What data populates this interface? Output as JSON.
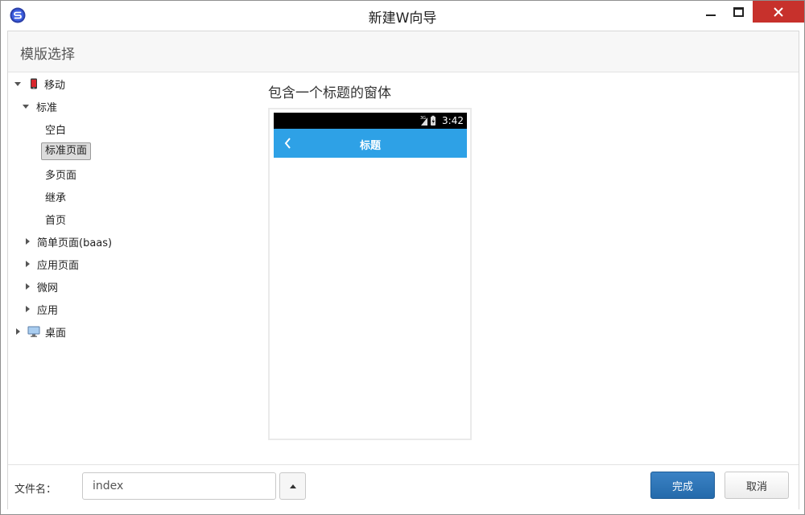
{
  "window": {
    "title": "新建W向导"
  },
  "header": {
    "title": "模版选择"
  },
  "tree": {
    "items": [
      {
        "label": "移动",
        "expanded": true,
        "icon": "mobile-icon"
      },
      {
        "label": "标准",
        "expanded": true
      },
      {
        "label": "空白"
      },
      {
        "label": "标准页面",
        "selected": true
      },
      {
        "label": "多页面"
      },
      {
        "label": "继承"
      },
      {
        "label": "首页"
      },
      {
        "label": "简单页面(baas)",
        "expanded": false
      },
      {
        "label": "应用页面",
        "expanded": false
      },
      {
        "label": "微网",
        "expanded": false
      },
      {
        "label": "应用",
        "expanded": false
      },
      {
        "label": "桌面",
        "expanded": false,
        "icon": "desktop-icon"
      }
    ]
  },
  "preview": {
    "title": "包含一个标题的窗体",
    "status_time": "3:42",
    "nav_title": "标题"
  },
  "footer": {
    "filename_label": "文件名：",
    "filename_value": "index",
    "finish_label": "完成",
    "cancel_label": "取消"
  },
  "colors": {
    "accent": "#2ea1e6",
    "primary_button": "#2a6fb0",
    "close_button": "#c7312c"
  }
}
